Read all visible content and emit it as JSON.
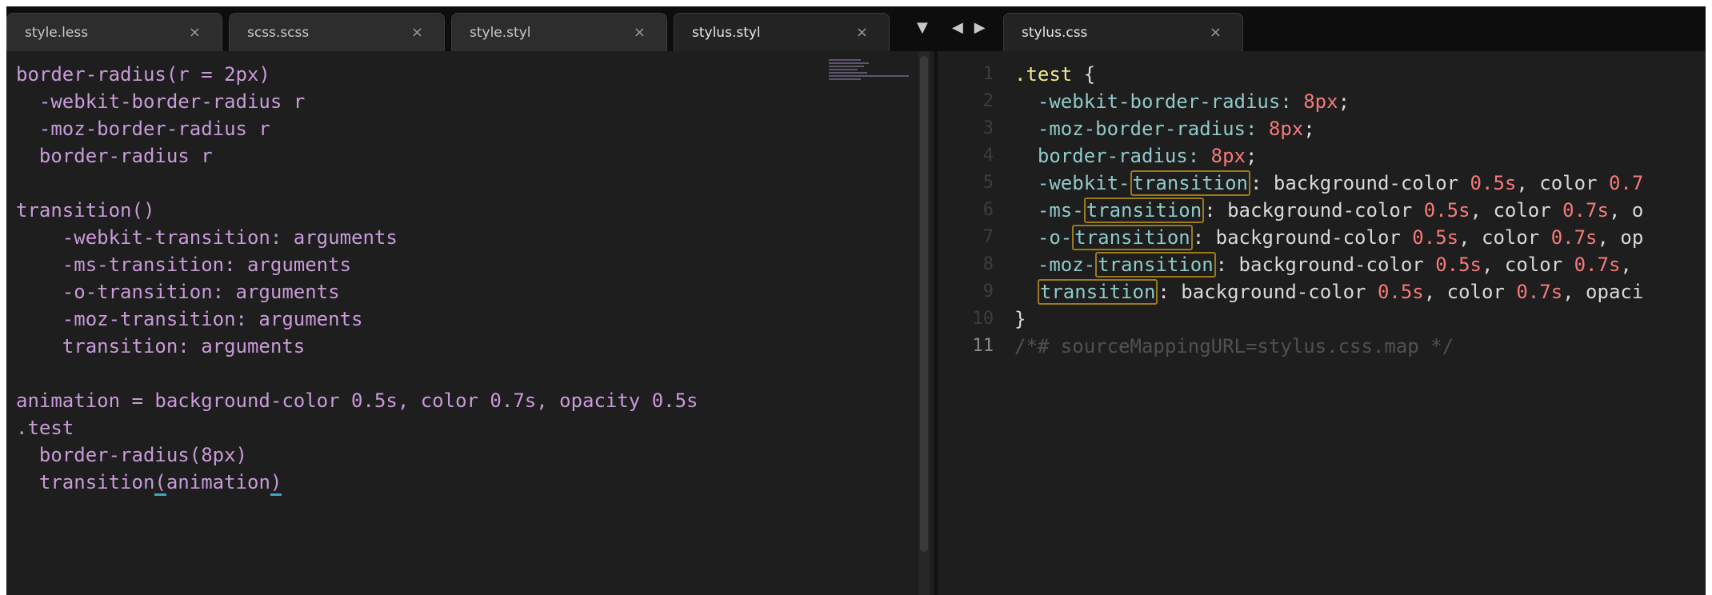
{
  "tabs": [
    {
      "label": "style.less",
      "close": "×"
    },
    {
      "label": "scss.scss",
      "close": "×"
    },
    {
      "label": "style.styl",
      "close": "×"
    },
    {
      "label": "stylus.styl",
      "close": "×"
    }
  ],
  "right_tab": {
    "label": "stylus.css",
    "close": "×"
  },
  "tab_menu_glyph": "▼",
  "nav_glyph": "◀ ▶",
  "left_code": {
    "l1": "border-radius(r = 2px)",
    "l2": "  -webkit-border-radius r",
    "l3": "  -moz-border-radius r",
    "l4": "  border-radius r",
    "l6": "transition()",
    "l7": "    -webkit-transition: arguments",
    "l8": "    -ms-transition: arguments",
    "l9": "    -o-transition: arguments",
    "l10": "    -moz-transition: arguments",
    "l11": "    transition: arguments",
    "l13": "animation = background-color 0.5s, color 0.7s, opacity 0.5s",
    "l14": ".test",
    "l15": "  border-radius(8px)",
    "l16a": "  transition",
    "l16b": "(",
    "l16c": "animation",
    "l16d": ")"
  },
  "right_code": {
    "gutter": [
      "1",
      "2",
      "3",
      "4",
      "5",
      "6",
      "7",
      "8",
      "9",
      "10",
      "11"
    ],
    "sel": ".test",
    "open": " {",
    "r2p": "  -webkit-border-radius: ",
    "r2n": "8px",
    "r2e": ";",
    "r3p": "  -moz-border-radius: ",
    "r3n": "8px",
    "r3e": ";",
    "r4p": "  border-radius: ",
    "r4n": "8px",
    "r4e": ";",
    "r5pre": "  -webkit-",
    "t": "transition",
    "r5a": ": background-color ",
    "r5n1": "0.5s",
    "r5b": ", color ",
    "r5n2": "0.7",
    "r6pre": "  -ms-",
    "r6a": ": background-color ",
    "r6n1": "0.5s",
    "r6b": ", color ",
    "r6n2": "0.7s",
    "r6c": ", o",
    "r7pre": "  -o-",
    "r7a": ": background-color ",
    "r7n1": "0.5s",
    "r7b": ", color ",
    "r7n2": "0.7s",
    "r7c": ", op",
    "r8pre": "  -moz-",
    "r8a": ": background-color ",
    "r8n1": "0.5s",
    "r8b": ", color ",
    "r8n2": "0.7s",
    "r8c": ",",
    "r9pre": "  ",
    "r9a": ": background-color ",
    "r9n1": "0.5s",
    "r9b": ", color ",
    "r9n2": "0.7s",
    "r9c": ", opaci",
    "close": "}",
    "comment": "/*# sourceMappingURL=stylus.css.map */"
  }
}
